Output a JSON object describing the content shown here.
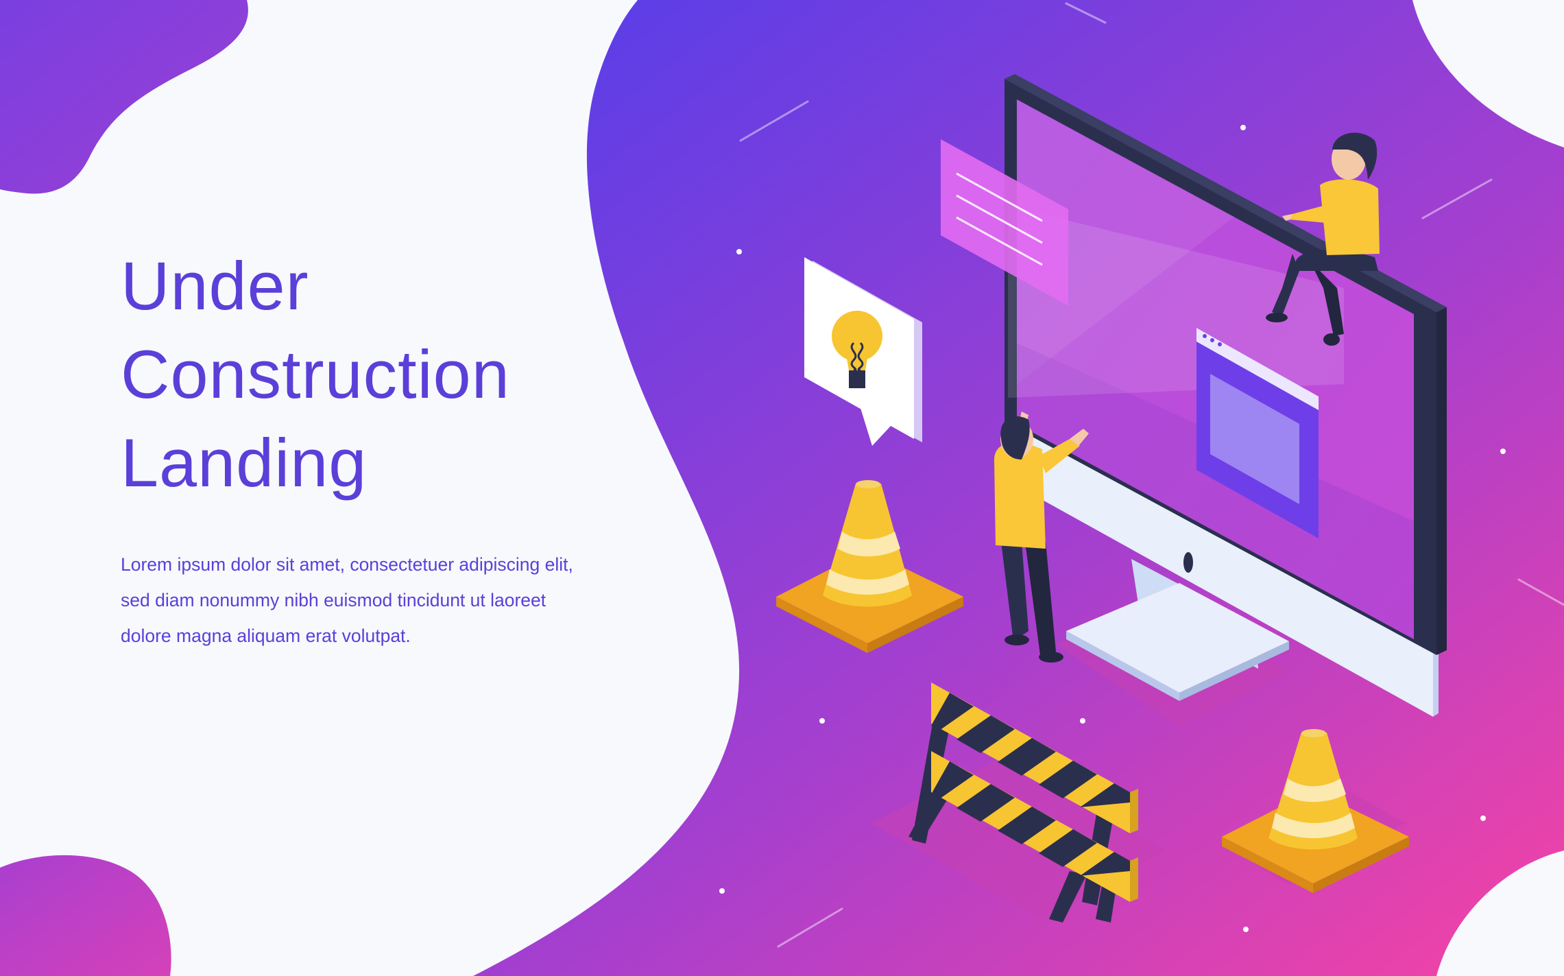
{
  "hero": {
    "title_lines": [
      "Under",
      "Construction",
      "Landing"
    ],
    "description": "Lorem ipsum dolor sit amet, consectetuer adipiscing elit, sed diam nonummy nibh euismod tincidunt ut laoreet dolore magna aliquam erat volutpat."
  },
  "theme": {
    "title_color": "#5b3fd9",
    "text_color": "#5b3fd9",
    "gradient_start": "#5b3de8",
    "gradient_end": "#f040a8",
    "cone_color": "#f7c531",
    "shirt_color": "#f9c737"
  },
  "illustration": {
    "icons": [
      "monitor-icon",
      "lightbulb-icon",
      "traffic-cone-icon",
      "barrier-icon",
      "browser-window-icon",
      "worker-figure"
    ]
  }
}
